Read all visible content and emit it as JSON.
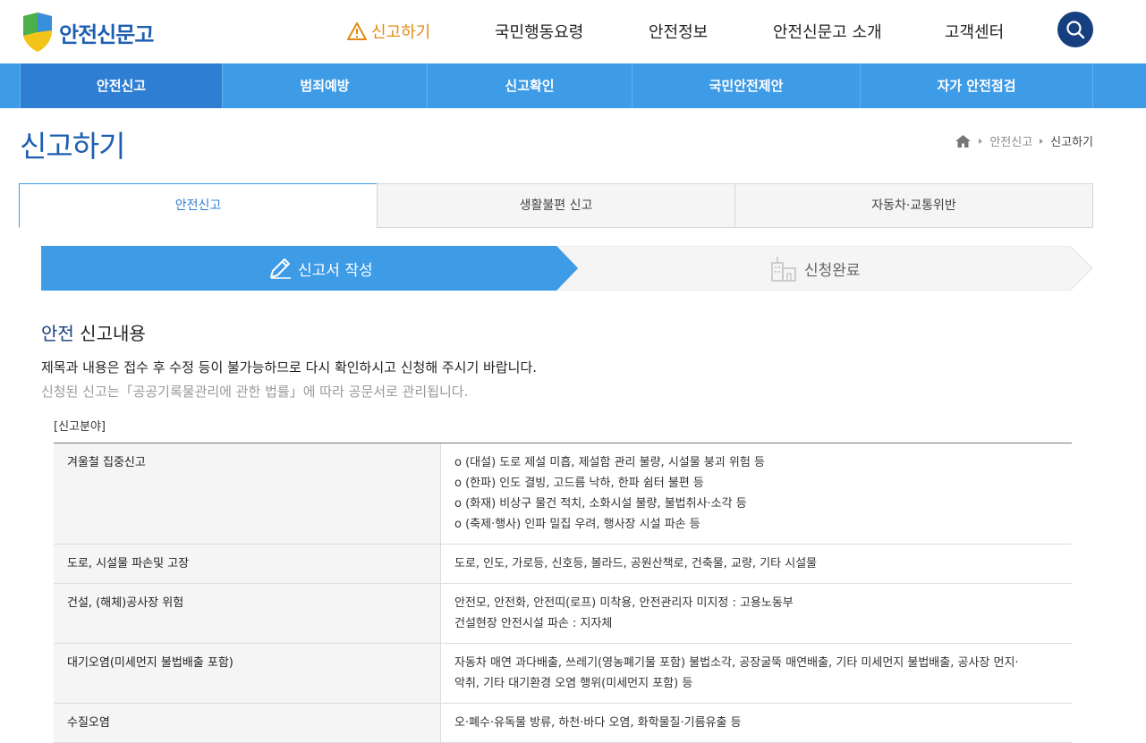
{
  "header": {
    "logo_text": "안전신문고",
    "nav": [
      {
        "label": "신고하기",
        "active": true
      },
      {
        "label": "국민행동요령"
      },
      {
        "label": "안전정보"
      },
      {
        "label": "안전신문고 소개"
      },
      {
        "label": "고객센터"
      }
    ],
    "search_icon": "search-icon"
  },
  "subnav": [
    {
      "label": "안전신고",
      "active": true
    },
    {
      "label": "범죄예방"
    },
    {
      "label": "신고확인"
    },
    {
      "label": "국민안전제안"
    },
    {
      "label": "자가 안전점검"
    }
  ],
  "page": {
    "title": "신고하기",
    "breadcrumb": [
      "안전신고",
      "신고하기"
    ]
  },
  "tabs": [
    {
      "label": "안전신고",
      "active": true
    },
    {
      "label": "생활불편 신고"
    },
    {
      "label": "자동차·교통위반"
    }
  ],
  "steps": [
    {
      "label": "신고서 작성",
      "active": true,
      "icon": "pencil-icon"
    },
    {
      "label": "신청완료",
      "active": false,
      "icon": "building-icon"
    }
  ],
  "content": {
    "title_accent": "안전",
    "title_rest": " 신고내용",
    "notice1": "제목과 내용은 접수 후 수정 등이 불가능하므로 다시 확인하시고 신청해 주시기 바랍니다.",
    "notice2": "신청된 신고는「공공기록물관리에 관한 법률」에 따라 공문서로 관리됩니다.",
    "table_caption": "[신고분야]",
    "rows": [
      {
        "category": "겨울철 집중신고",
        "details": [
          "o (대설) 도로 제설 미흡, 제설함 관리 불량, 시설물 붕괴 위험 등",
          "o (한파) 인도 결빙, 고드름 낙하, 한파 쉼터 불편 등",
          "o (화재) 비상구 물건 적치, 소화시설 불량, 불법취사·소각 등",
          "o (축제·행사) 인파 밀집 우려, 행사장 시설 파손 등"
        ]
      },
      {
        "category": "도로, 시설물 파손및 고장",
        "details": [
          "도로, 인도, 가로등, 신호등, 볼라드, 공원산책로, 건축물, 교량, 기타 시설물"
        ]
      },
      {
        "category": "건설, (해체)공사장 위험",
        "details": [
          "안전모, 안전화, 안전띠(로프) 미착용, 안전관리자 미지정 : 고용노동부",
          "건설현장 안전시설 파손 : 지자체"
        ]
      },
      {
        "category": "대기오염(미세먼지 불법배출 포함)",
        "details": [
          "자동차 매연 과다배출, 쓰레기(영농폐기물 포함) 불법소각, 공장굴뚝 매연배출, 기타 미세먼지 불법배출, 공사장 먼지·",
          "악취, 기타 대기환경 오염 행위(미세먼지 포함) 등"
        ]
      },
      {
        "category": "수질오염",
        "details": [
          "오·폐수·유독물 방류, 하천·바다 오염, 화학물질·기름유출 등"
        ]
      }
    ]
  }
}
